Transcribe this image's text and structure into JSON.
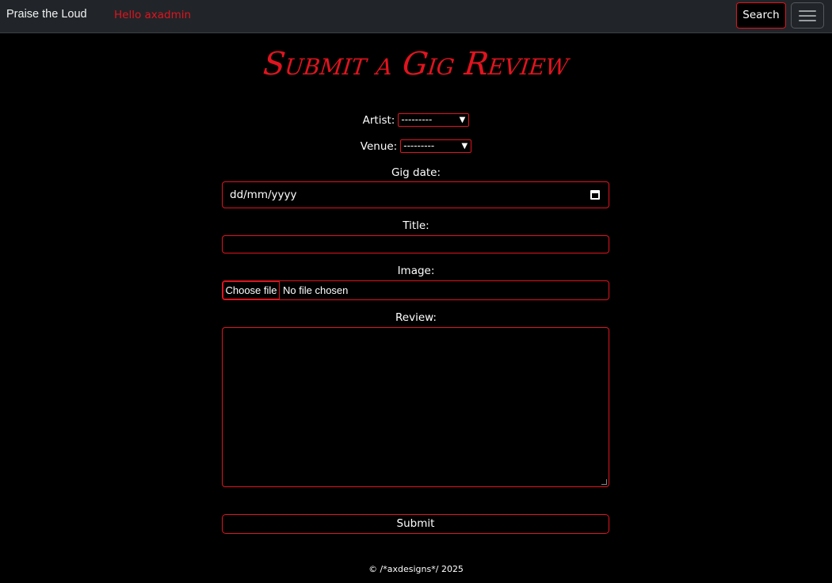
{
  "navbar": {
    "brand": "Praise the Loud",
    "greeting": "Hello axadmin",
    "search_label": "Search",
    "menu_icon": "hamburger-menu-icon"
  },
  "page": {
    "title": "Submit a Gig Review"
  },
  "form": {
    "artist_label": "Artist:",
    "artist_value": "---------",
    "venue_label": "Venue:",
    "venue_value": "---------",
    "gig_date_label": "Gig date:",
    "gig_date_placeholder": "dd/mm/yyyy",
    "title_label": "Title:",
    "title_value": "",
    "image_label": "Image:",
    "choose_file_label": "Choose file",
    "file_status": "No file chosen",
    "review_label": "Review:",
    "review_value": "",
    "submit_label": "Submit"
  },
  "footer": {
    "text": "© /*axdesigns*/ 2025"
  },
  "colors": {
    "accent": "#e0141e",
    "navbar_bg": "#212529",
    "page_bg": "#000000"
  }
}
